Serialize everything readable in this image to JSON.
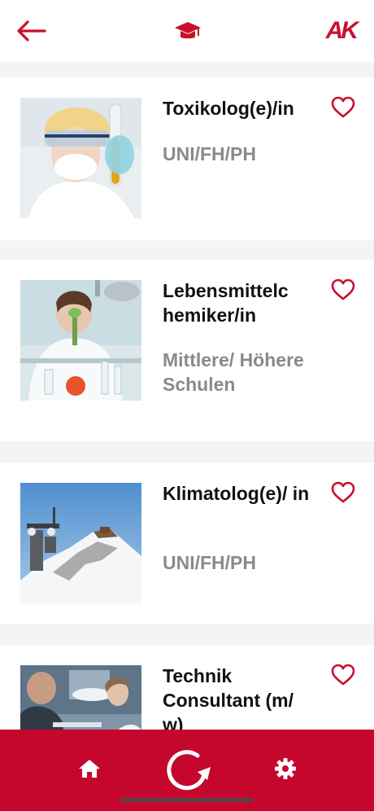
{
  "header": {
    "back_icon": "arrow-left-icon",
    "center_icon": "graduation-cap-icon",
    "logo_text": "AK"
  },
  "colors": {
    "accent": "#c8102e",
    "tabbar": "#c5072e",
    "title": "#111111",
    "subtitle": "#8a8a8a",
    "separator": "#f4f4f4"
  },
  "jobs": [
    {
      "title": "Toxikolog(e)/in",
      "subtitle": "UNI/FH/PH",
      "favorite": false,
      "image": "scientist-with-test-tube"
    },
    {
      "title": "Lebensmittelc hemiker/in",
      "subtitle": "Mittlere/ Höhere Schulen",
      "favorite": false,
      "image": "food-chemist-lab"
    },
    {
      "title": "Klimatolog(e)/ in",
      "subtitle": "UNI/FH/PH",
      "favorite": false,
      "image": "snowy-mountain-station"
    },
    {
      "title": "Technik Consultant (m/ w)",
      "subtitle": "",
      "favorite": false,
      "image": "consultants-at-desk"
    }
  ],
  "tabbar": {
    "items": [
      "home-icon",
      "refresh-icon",
      "settings-icon"
    ]
  }
}
